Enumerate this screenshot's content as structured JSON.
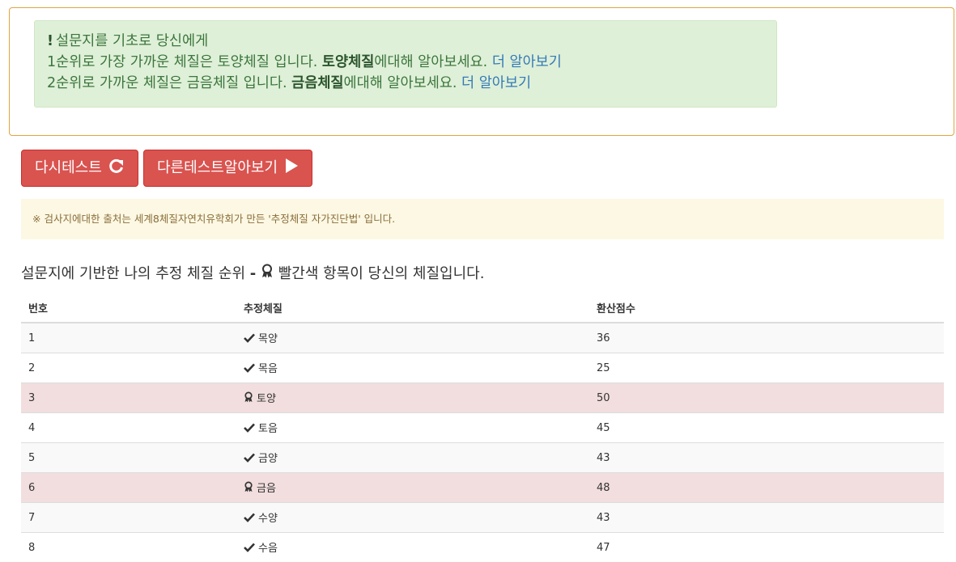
{
  "alert": {
    "line0": "설문지를 기초로 당신에게",
    "line1_pre": "1순위로 가장 가까운 체질은 토양체질 입니다.",
    "line1_bold": "토양체질",
    "line1_mid": "에대해 알아보세요.",
    "line1_link": "더 알아보기",
    "line2_pre": "2순위로 가까운 체질은 금음체질 입니다.",
    "line2_bold": "금음체질",
    "line2_mid": "에대해 알아보세요.",
    "line2_link": "더 알아보기"
  },
  "buttons": {
    "retest": "다시테스트",
    "other_tests": "다른테스트알아보기"
  },
  "note": "※ 검사지에대한 출처는 세계8체질자연치유학회가 만든 '추정체질 자가진단법' 입니다.",
  "heading": {
    "pre": "설문지에 기반한 나의 추정 체질 순위",
    "sep": "-",
    "post": "빨간색 항목이 당신의 체질입니다."
  },
  "table": {
    "headers": [
      "번호",
      "추정체질",
      "환산점수"
    ],
    "rows": [
      {
        "no": "1",
        "type": "목양",
        "score": "36",
        "highlight": false
      },
      {
        "no": "2",
        "type": "목음",
        "score": "25",
        "highlight": false
      },
      {
        "no": "3",
        "type": "토양",
        "score": "50",
        "highlight": true
      },
      {
        "no": "4",
        "type": "토음",
        "score": "45",
        "highlight": false
      },
      {
        "no": "5",
        "type": "금양",
        "score": "43",
        "highlight": false
      },
      {
        "no": "6",
        "type": "금음",
        "score": "48",
        "highlight": true
      },
      {
        "no": "7",
        "type": "수양",
        "score": "43",
        "highlight": false
      },
      {
        "no": "8",
        "type": "수음",
        "score": "47",
        "highlight": false
      }
    ]
  },
  "icons": {
    "retest": "refresh-icon",
    "other_tests": "play-icon",
    "normal_row": "check-icon",
    "highlight_row": "award-icon"
  }
}
